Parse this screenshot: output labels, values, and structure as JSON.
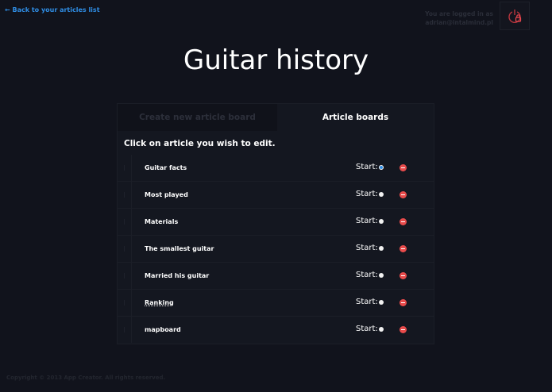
{
  "header": {
    "back_link": "← Back to your articles list",
    "login_line1": "You are logged in as",
    "login_line2": "adrian@intalmind.pl"
  },
  "page": {
    "title": "Guitar history"
  },
  "tabs": [
    {
      "label": "Create new article board",
      "active": false
    },
    {
      "label": "Article boards",
      "active": true
    }
  ],
  "instruction": "Click on article you wish to edit.",
  "start_label": "Start:",
  "articles": [
    {
      "title": "Guitar facts",
      "start": true
    },
    {
      "title": "Most played",
      "start": false
    },
    {
      "title": "Materials",
      "start": false
    },
    {
      "title": "The smallest guitar",
      "start": false
    },
    {
      "title": "Married his guitar",
      "start": false
    },
    {
      "title": "Ranking",
      "start": false
    },
    {
      "title": "mapboard",
      "start": false
    }
  ],
  "footer": {
    "copyright": "Copyright © 2013 App Creator. All rights reserved."
  },
  "icons": {
    "logout": "power-lock-icon",
    "delete": "minus-circle-icon",
    "drag": "drag-handle-icon"
  },
  "colors": {
    "background": "#11131c",
    "accent": "#2f8de4",
    "delete": "#e84b4b"
  }
}
